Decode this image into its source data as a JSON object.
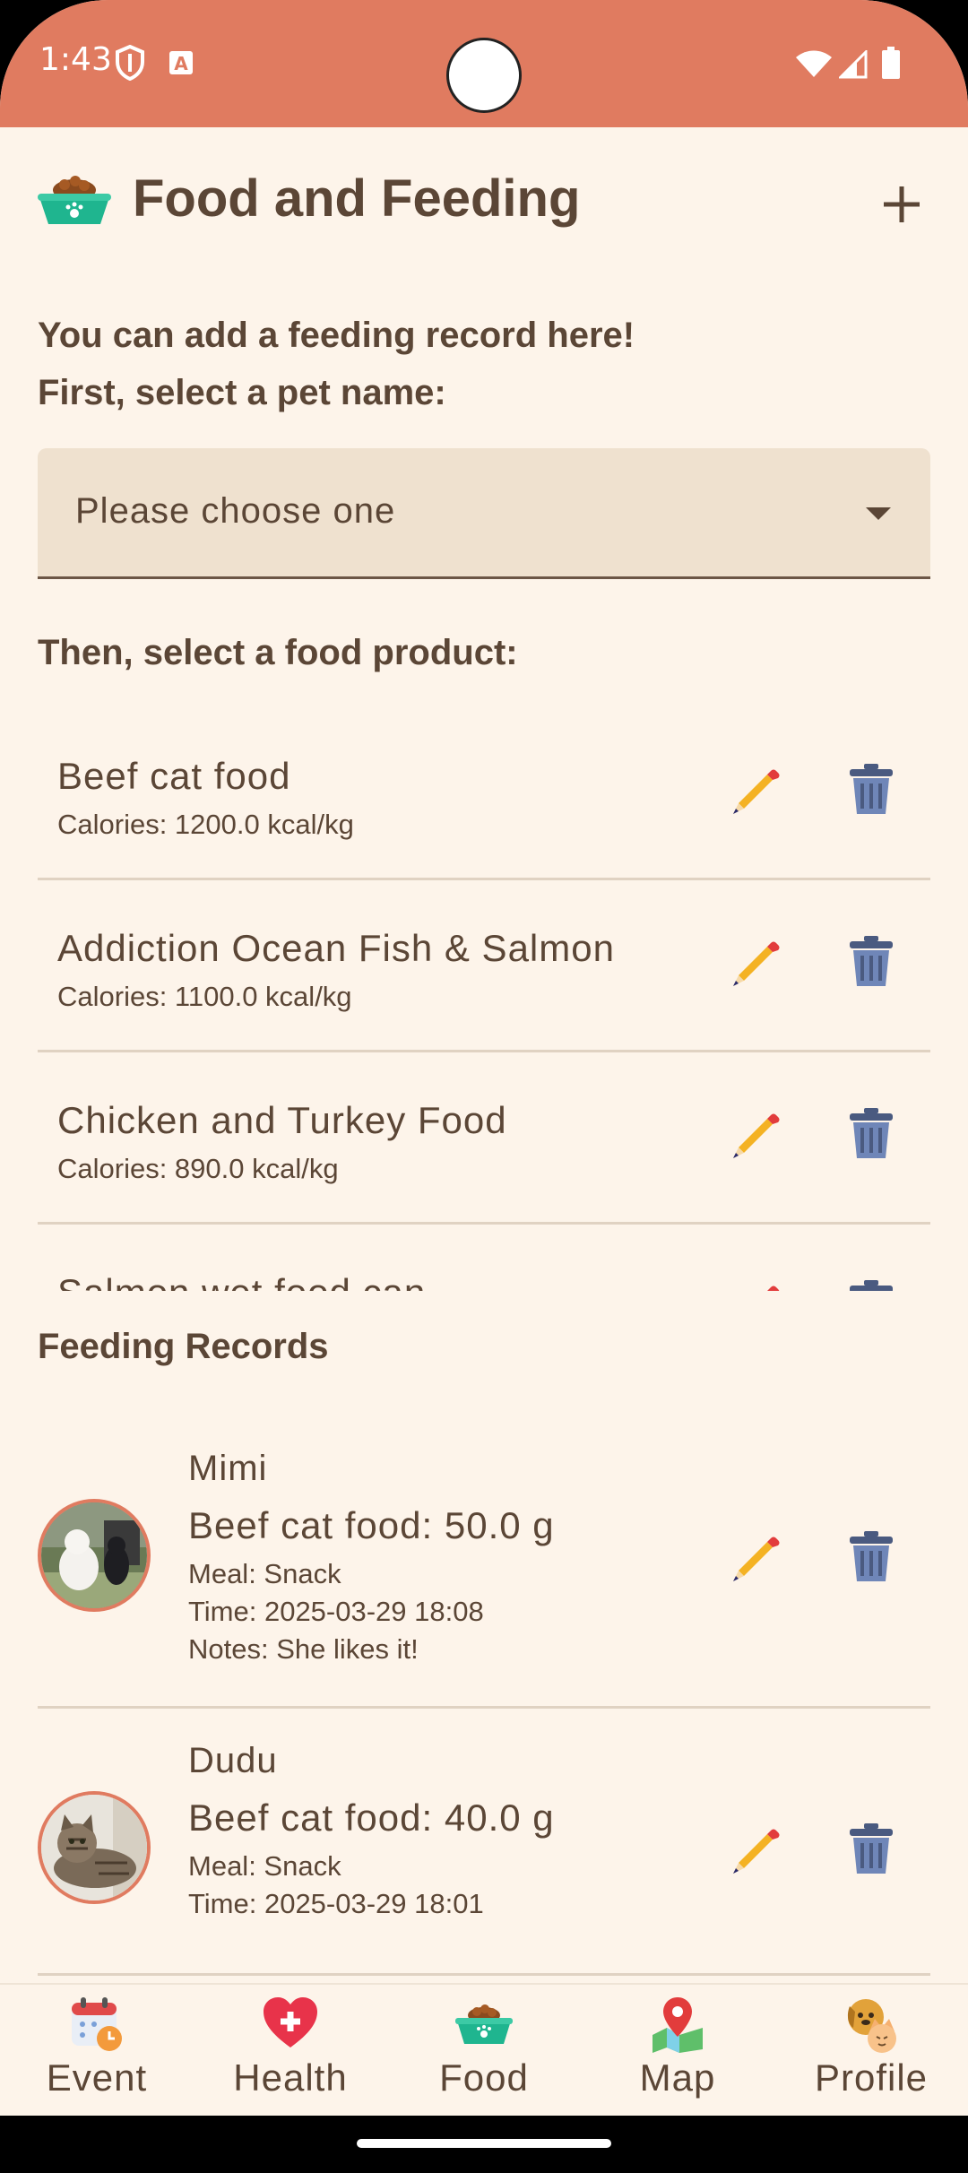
{
  "status_bar": {
    "time": "1:43"
  },
  "header": {
    "title": "Food and Feeding"
  },
  "intro": {
    "line1": "You can add a feeding record here!",
    "line2": "First, select a pet name:"
  },
  "pet_select": {
    "value": "Please choose one"
  },
  "products_label": "Then, select a food product:",
  "products": [
    {
      "name": "Beef cat food",
      "calories": "Calories: 1200.0 kcal/kg"
    },
    {
      "name": "Addiction Ocean Fish & Salmon",
      "calories": "Calories: 1100.0 kcal/kg"
    },
    {
      "name": "Chicken and Turkey Food",
      "calories": "Calories: 890.0 kcal/kg"
    },
    {
      "name": "Salmon wet food can",
      "calories": ""
    }
  ],
  "records_title": "Feeding Records",
  "records": [
    {
      "pet": "Mimi",
      "food": "Beef cat food: 50.0 g",
      "meal": "Meal: Snack",
      "time": "Time: 2025-03-29 18:08",
      "notes": "Notes: She likes it!"
    },
    {
      "pet": "Dudu",
      "food": "Beef cat food: 40.0 g",
      "meal": "Meal: Snack",
      "time": "Time: 2025-03-29 18:01"
    }
  ],
  "nav": [
    {
      "label": "Event",
      "icon": "calendar-icon"
    },
    {
      "label": "Health",
      "icon": "heart-icon"
    },
    {
      "label": "Food",
      "icon": "food-bowl-icon"
    },
    {
      "label": "Map",
      "icon": "map-icon"
    },
    {
      "label": "Profile",
      "icon": "dog-cat-icon"
    }
  ],
  "colors": {
    "accent": "#e07b60",
    "background": "#fdf4ea",
    "text": "#5b4636",
    "dropdown_bg": "#efe1cf"
  }
}
